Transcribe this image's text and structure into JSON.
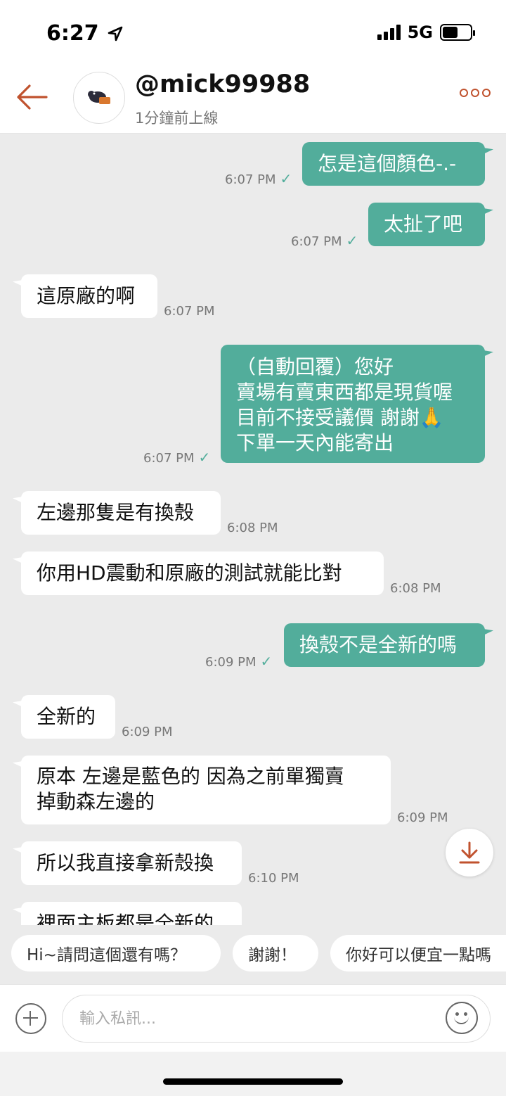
{
  "status_bar": {
    "time": "6:27",
    "network": "5G"
  },
  "header": {
    "username": "@mick99988",
    "status": "1分鐘前上線"
  },
  "messages": [
    {
      "dir": "out",
      "text": "怎是這個顏色-.-",
      "time": "6:07 PM"
    },
    {
      "dir": "out",
      "text": "太扯了吧",
      "time": "6:07 PM"
    },
    {
      "dir": "in",
      "text": "這原廠的啊",
      "time": "6:07 PM"
    },
    {
      "dir": "out",
      "text": "（自動回覆）您好\n賣場有賣東西都是現貨喔\n目前不接受議價 謝謝🙏\n下單一天內能寄出",
      "time": "6:07 PM"
    },
    {
      "dir": "in",
      "text": "左邊那隻是有換殼",
      "time": "6:08 PM"
    },
    {
      "dir": "in",
      "text": "你用HD震動和原廠的測試就能比對",
      "time": "6:08 PM"
    },
    {
      "dir": "out",
      "text": "換殼不是全新的嗎",
      "time": "6:09 PM"
    },
    {
      "dir": "in",
      "text": "全新的",
      "time": "6:09 PM"
    },
    {
      "dir": "in",
      "text": "原本 左邊是藍色的   因為之前單獨賣\n掉動森左邊的",
      "time": "6:09 PM"
    },
    {
      "dir": "in",
      "text": "所以我直接拿新殼換",
      "time": "6:10 PM"
    },
    {
      "dir": "in",
      "text": "裡面主板都是全新的",
      "time": ""
    }
  ],
  "quick_replies": [
    "Hi~請問這個還有嗎？",
    "謝謝！",
    "你好可以便宜一點嗎"
  ],
  "input": {
    "placeholder": "輸入私訊..."
  },
  "colors": {
    "accent": "#c0522e",
    "bubble_out": "#52ad9b",
    "chat_bg": "#ebebeb"
  }
}
